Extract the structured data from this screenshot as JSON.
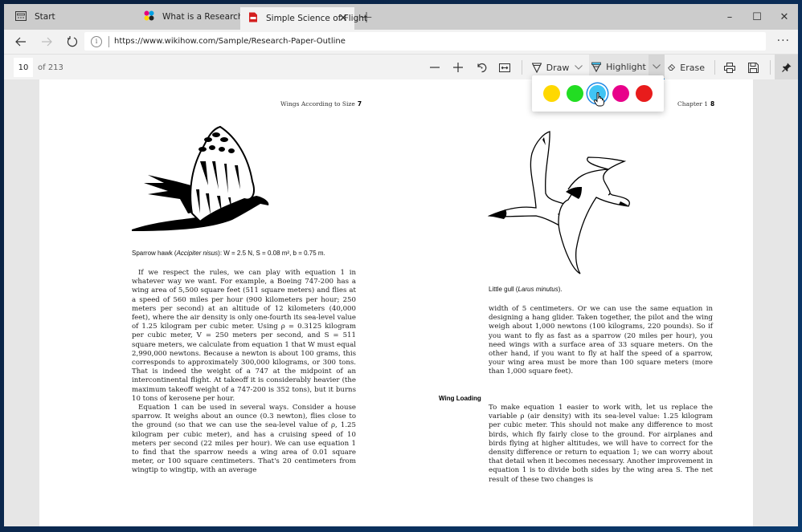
{
  "tabs": [
    {
      "label": "Start",
      "icon": "start-page-icon",
      "active": false
    },
    {
      "label": "What is a Research paper?",
      "icon": "colorful-dots-icon",
      "active": false
    },
    {
      "label": "Simple Science of Flight",
      "icon": "pdf-icon",
      "active": true
    }
  ],
  "window_controls": {
    "minimize": "–",
    "maximize": "☐",
    "close": "✕"
  },
  "address_bar": {
    "url": "https://www.wikihow.com/Sample/Research-Paper-Outline",
    "more": "···"
  },
  "pdf_toolbar": {
    "current_page": "10",
    "page_count": "of 213",
    "draw_label": "Draw",
    "highlight_label": "Highlight",
    "erase_label": "Erase"
  },
  "highlight_colors": [
    {
      "name": "yellow",
      "hex": "#ffd800",
      "selected": false
    },
    {
      "name": "green",
      "hex": "#22dd22",
      "selected": false
    },
    {
      "name": "blue",
      "hex": "#40c4f4",
      "selected": true
    },
    {
      "name": "pink",
      "hex": "#e8008a",
      "selected": false
    },
    {
      "name": "red",
      "hex": "#e81c1c",
      "selected": false
    }
  ],
  "left_page": {
    "running_head": "Wings According to Size",
    "page_number": "7",
    "figure_caption_pre": "Sparrow hawk (",
    "figure_caption_italic": "Accipiter nisus",
    "figure_caption_post": "): W = 2.5 N, S = 0.08 m², b = 0.75 m.",
    "paragraphs": [
      "If we respect the rules, we can play with equation 1 in whatever way we want. For example, a Boeing 747-200 has a wing area of 5,500 square feet (511 square meters) and flies at a speed of 560 miles per hour (900 kilometers per hour; 250 meters per second) at an altitude of 12 kilometers (40,000 feet), where the air density is only one-fourth its sea-level value of 1.25 kilogram per cubic meter. Using ρ = 0.3125 kilogram per cubic meter, V = 250 meters per second, and S = 511 square meters, we calculate from equation 1 that W must equal 2,990,000 newtons. Because a newton is about 100 grams, this corresponds to approximately 300,000 kilograms, or 300 tons. That is indeed the weight of a 747 at the midpoint of an intercontinental flight. At takeoff it is considerably heavier (the maximum takeoff weight of a 747-200 is 352 tons), but it burns 10 tons of kerosene per hour.",
      "Equation 1 can be used in several ways. Consider a house sparrow. It weighs about an ounce (0.3 newton), flies close to the ground (so that we can use the sea-level value of ρ, 1.25 kilogram per cubic meter), and has a cruising speed of 10 meters per second (22 miles per hour). We can use equation 1 to find that the sparrow needs a wing area of 0.01 square meter, or 100 square centimeters. That's 20 centimeters from wingtip to wingtip, with an average"
    ]
  },
  "right_page": {
    "running_head": "Chapter 1",
    "page_number": "8",
    "figure_caption_pre": "Little gull (",
    "figure_caption_italic": "Larus minutus",
    "figure_caption_post": ").",
    "continuation": "width of 5 centimeters. Or we can use the same equation in designing a hang glider. Taken together, the pilot and the wing weigh about 1,000 newtons (100 kilograms, 220 pounds). So if you want to fly as fast as a sparrow (20 miles per hour), you need wings with a surface area of 33 square meters. On the other hand, if you want to fly at half the speed of a sparrow, your wing area must be more than 100 square meters (more than 1,000 square feet).",
    "section_heading": "Wing Loading",
    "section_paragraph": "To make equation 1 easier to work with, let us replace the variable ρ (air density) with its sea-level value: 1.25 kilogram per cubic meter. This should not make any difference to most birds, which fly fairly close to the ground. For airplanes and birds flying at higher altitudes, we will have to correct for the density difference or return to equation 1; we can worry about that detail when it becomes necessary. Another improvement in equation 1 is to divide both sides by the wing area S. The net result of these two changes is"
  }
}
